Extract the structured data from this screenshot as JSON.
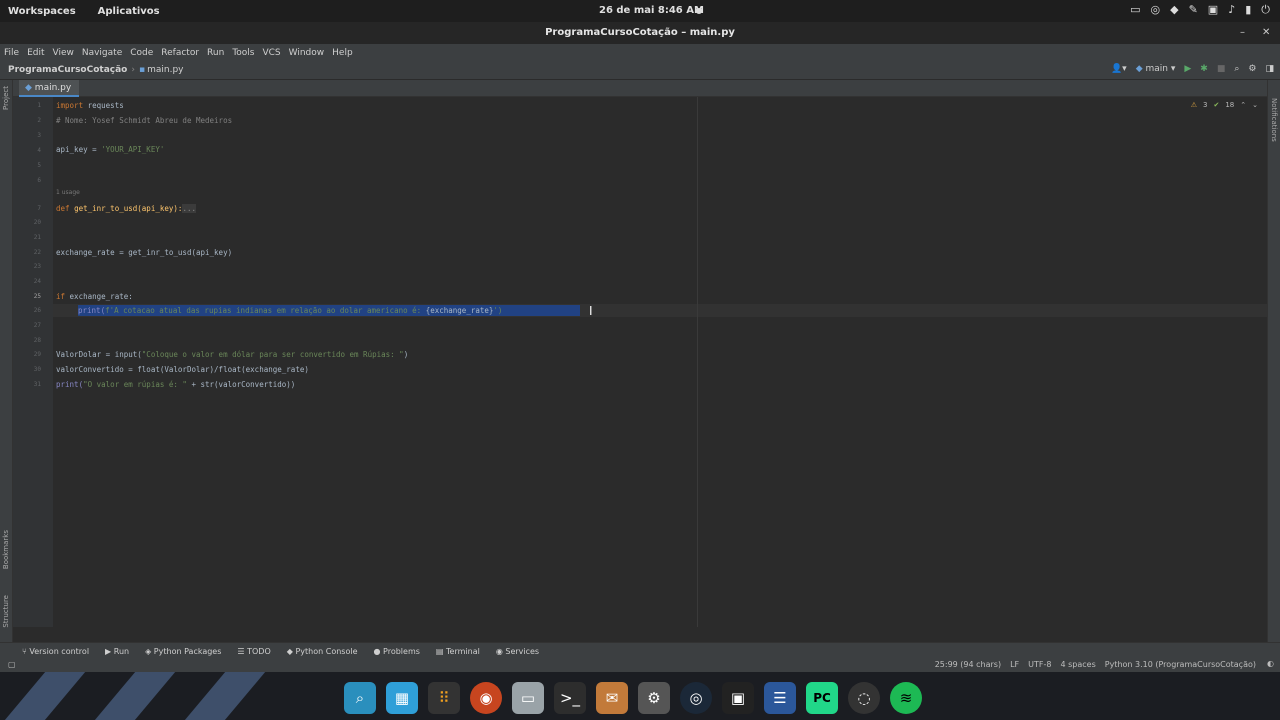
{
  "topbar": {
    "workspaces": "Workspaces",
    "apps": "Aplicativos",
    "datetime": "26 de mai  8:46 AM"
  },
  "window": {
    "title": "ProgramaCursoCotação – main.py"
  },
  "menu": [
    "File",
    "Edit",
    "View",
    "Navigate",
    "Code",
    "Refactor",
    "Run",
    "Tools",
    "VCS",
    "Window",
    "Help"
  ],
  "breadcrumb": {
    "project": "ProgramaCursoCotação",
    "file": "main.py"
  },
  "branch": "main",
  "tab": "main.py",
  "inspections": {
    "warnings": "3",
    "weak": "18"
  },
  "side_left": {
    "project": "Project",
    "bookmarks": "Bookmarks",
    "structure": "Structure"
  },
  "side_right": {
    "notifications": "Notifications"
  },
  "code": {
    "l1_kw": "import",
    "l1_rest": " requests",
    "l2": "# Nome: Yosef Schmidt Abreu de Medeiros",
    "l4_a": "api_key = ",
    "l4_s": "'YOUR_API_KEY'",
    "usage": "1 usage",
    "l7_kw": "def ",
    "l7_rest": "get_inr_to_usd(api_key):",
    "l7_fold": "...",
    "l21": "exchange_rate = get_inr_to_usd(api_key)",
    "l24_kw": "if ",
    "l24_rest": "exchange_rate:",
    "l25_a": "print(",
    "l25_s": "f'A cotacao atual das rupias indianas em relação ao dolar americano é: ",
    "l25_b": "{exchange_rate}",
    "l25_e": "')",
    "l28_a": "ValorDolar = input(",
    "l28_s": "\"Coloque o valor em dólar para ser convertido em Rúpias: \"",
    "l28_e": ")",
    "l29": "valorConvertido = float(ValorDolar)/float(exchange_rate)",
    "l30_a": "print(",
    "l30_s": "\"O valor em rúpias é: \"",
    "l30_e": " + str(valorConvertido))"
  },
  "line_numbers": [
    "1",
    "2",
    "3",
    "4",
    "5",
    "6",
    "7",
    "20",
    "21",
    "22",
    "23",
    "24",
    "25",
    "26",
    "27",
    "28",
    "29",
    "30",
    "31"
  ],
  "toolwindows": [
    "Version control",
    "Run",
    "Python Packages",
    "TODO",
    "Python Console",
    "Problems",
    "Terminal",
    "Services"
  ],
  "status": {
    "pos": "25:99 (94 chars)",
    "lf": "LF",
    "enc": "UTF-8",
    "indent": "4 spaces",
    "interp": "Python 3.10 (ProgramaCursoCotação)"
  }
}
